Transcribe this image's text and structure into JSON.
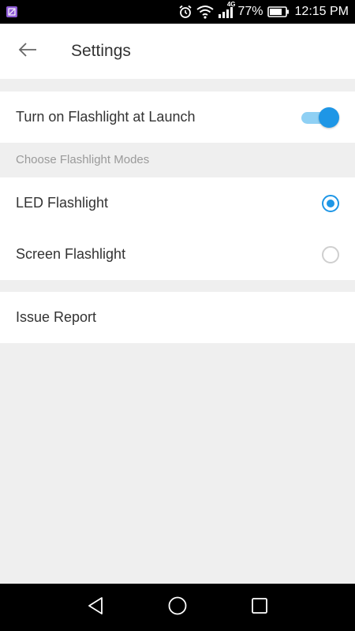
{
  "status_bar": {
    "network_label": "4G",
    "battery_percent": "77%",
    "time": "12:15 PM"
  },
  "header": {
    "title": "Settings"
  },
  "settings": {
    "flashlight_at_launch": {
      "label": "Turn on Flashlight at Launch",
      "enabled": true
    },
    "modes_section_label": "Choose Flashlight Modes",
    "modes": [
      {
        "label": "LED Flashlight",
        "selected": true
      },
      {
        "label": "Screen Flashlight",
        "selected": false
      }
    ],
    "issue_report_label": "Issue Report"
  },
  "colors": {
    "accent": "#1e96e6",
    "accent_light": "#8fd0f4",
    "background": "#efefef"
  }
}
